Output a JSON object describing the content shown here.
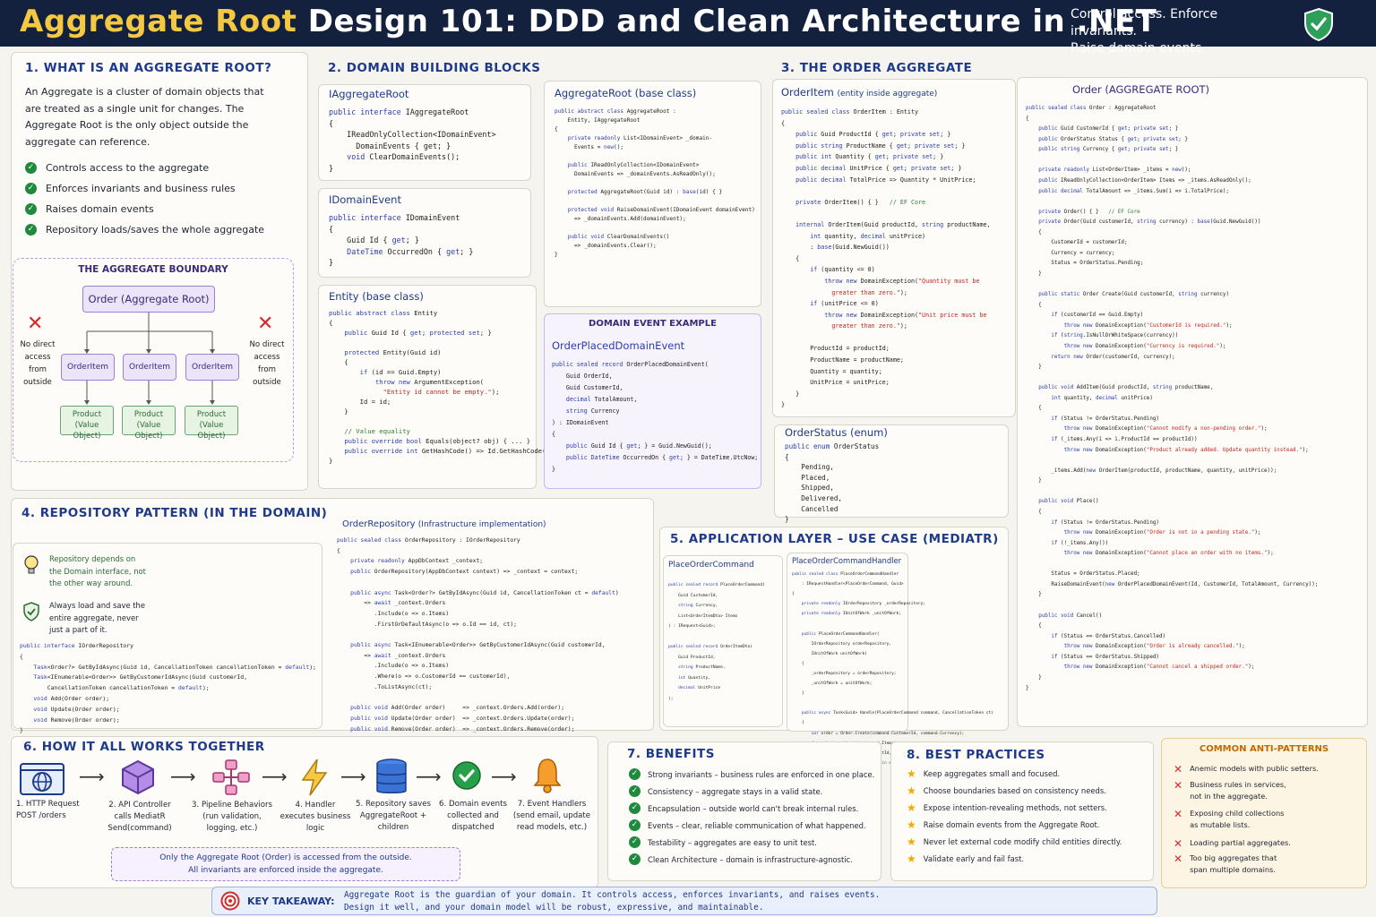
{
  "header": {
    "title_highlight": "Aggregate Root",
    "title_rest": "Design 101: DDD and Clean Architecture in .NET",
    "tagline1": "Control access. Enforce invariants.",
    "tagline2": "Raise domain events."
  },
  "s1": {
    "title": "1. What is an Aggregate Root?",
    "intro": "An Aggregate is a cluster of domain objects that are treated as a single unit for changes. The Aggregate Root is the only object outside the aggregate can reference.",
    "points": [
      "Controls access to the aggregate",
      "Enforces invariants and business rules",
      "Raises domain events",
      "Repository loads/saves the whole aggregate"
    ],
    "boundary_title": "The Aggregate Boundary",
    "root_label": "Order (Aggregate Root)",
    "item_label": "OrderItem",
    "vo_label1": "Product",
    "vo_label2": "(Value Object)",
    "no_access": "No direct access from outside"
  },
  "s2": {
    "title": "2. Domain Building Blocks",
    "iagg_title": "IAggregateRoot",
    "idomain_title": "IDomainEvent",
    "entity_title": "Entity (base class)",
    "aggbase_title": "AggregateRoot (base class)",
    "example_title": "Domain Event Example",
    "example_name": "OrderPlacedDomainEvent"
  },
  "s3": {
    "title": "3. The Order Aggregate",
    "orderitem_title": "OrderItem",
    "orderitem_sub": "(entity inside aggregate)",
    "status_title": "OrderStatus (enum)",
    "order_title": "Order (AGGREGATE ROOT)"
  },
  "s4": {
    "title": "4. Repository Pattern (in the Domain)",
    "tip1": "Repository depends on the Domain interface, not the other way around.",
    "tip2": "Always load and save the entire aggregate, never just a part of it.",
    "repo_title": "OrderRepository",
    "repo_sub": "(Infrastructure implementation)"
  },
  "s5": {
    "title": "5. Application Layer – Use Case (MediatR)",
    "cmd_title": "PlaceOrderCommand",
    "handler_title": "PlaceOrderCommandHandler"
  },
  "s6": {
    "title": "6. How It All Works Together",
    "steps": [
      "1. HTTP Request POST /orders",
      "2. API Controller calls MediatR Send(command)",
      "3. Pipeline Behaviors (run validation, logging, etc.)",
      "4. Handler executes business logic",
      "5. Repository saves AggregateRoot + children",
      "6. Domain events collected and dispatched",
      "7. Event Handlers (send email, update read models, etc.)"
    ],
    "note1": "Only the Aggregate Root (Order) is accessed from the outside.",
    "note2": "All invariants are enforced inside the aggregate."
  },
  "s7": {
    "title": "7. Benefits",
    "items": [
      "Strong invariants – business rules are enforced in one place.",
      "Consistency – aggregate stays in a valid state.",
      "Encapsulation – outside world can't break internal rules.",
      "Events – clear, reliable communication of what happened.",
      "Testability – aggregates are easy to unit test.",
      "Clean Architecture – domain is infrastructure-agnostic."
    ]
  },
  "s8": {
    "title": "8. Best Practices",
    "items": [
      "Keep aggregates small and focused.",
      "Choose boundaries based on consistency needs.",
      "Expose intention-revealing methods, not setters.",
      "Raise domain events from the Aggregate Root.",
      "Never let external code modify child entities directly.",
      "Validate early and fail fast."
    ]
  },
  "anti": {
    "title": "Common Anti-Patterns",
    "items": [
      "Anemic models with public setters.",
      "Business rules in services, not in the aggregate.",
      "Exposing child collections as mutable lists.",
      "Loading partial aggregates.",
      "Too big aggregates that span multiple domains."
    ]
  },
  "takeaway": {
    "label": "Key Takeaway:",
    "line1": "Aggregate Root is the guardian of your domain. It controls access, enforces invariants, and raises events.",
    "line2": "Design it well, and your domain model will be robust, expressive, and maintainable."
  },
  "colors": {
    "navy": "#13213f",
    "accent": "#f5c842",
    "section": "#1e3a8a",
    "green": "#1f8a3d",
    "red": "#d42a2a",
    "purple": "#9b7fd1"
  }
}
